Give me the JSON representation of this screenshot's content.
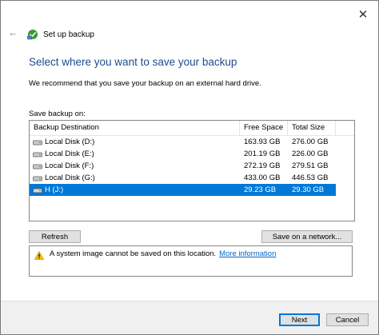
{
  "window": {
    "title": "Set up backup",
    "close_glyph": "✕",
    "back_glyph": "←",
    "icons": {
      "close": "close-icon",
      "back": "back-arrow-icon",
      "backup": "backup-icon"
    }
  },
  "page": {
    "heading": "Select where you want to save your backup",
    "intro": "We recommend that you save your backup on an external hard drive.",
    "save_label": "Save backup on:"
  },
  "table": {
    "columns": [
      "Backup Destination",
      "Free Space",
      "Total Size"
    ],
    "rows": [
      {
        "name": "Local Disk (D:)",
        "free": "163.93 GB",
        "total": "276.00 GB",
        "icon": "hard-disk-icon",
        "selected": false
      },
      {
        "name": "Local Disk (E:)",
        "free": "201.19 GB",
        "total": "226.00 GB",
        "icon": "hard-disk-icon",
        "selected": false
      },
      {
        "name": "Local Disk (F:)",
        "free": "272.19 GB",
        "total": "279.51 GB",
        "icon": "hard-disk-icon",
        "selected": false
      },
      {
        "name": "Local Disk (G:)",
        "free": "433.00 GB",
        "total": "446.53 GB",
        "icon": "hard-disk-icon",
        "selected": false
      },
      {
        "name": "H (J:)",
        "free": "29.23 GB",
        "total": "29.30 GB",
        "icon": "usb-drive-icon",
        "selected": true
      }
    ]
  },
  "buttons": {
    "refresh": "Refresh",
    "save_network": "Save on a network...",
    "next": "Next",
    "cancel": "Cancel"
  },
  "message": {
    "text": "A system image cannot be saved on this location.",
    "link": "More information",
    "icon": "warning-icon"
  },
  "colors": {
    "heading": "#1d4b8f",
    "selection": "#0078d7",
    "link": "#0066cc",
    "footer": "#f0f0f0"
  }
}
